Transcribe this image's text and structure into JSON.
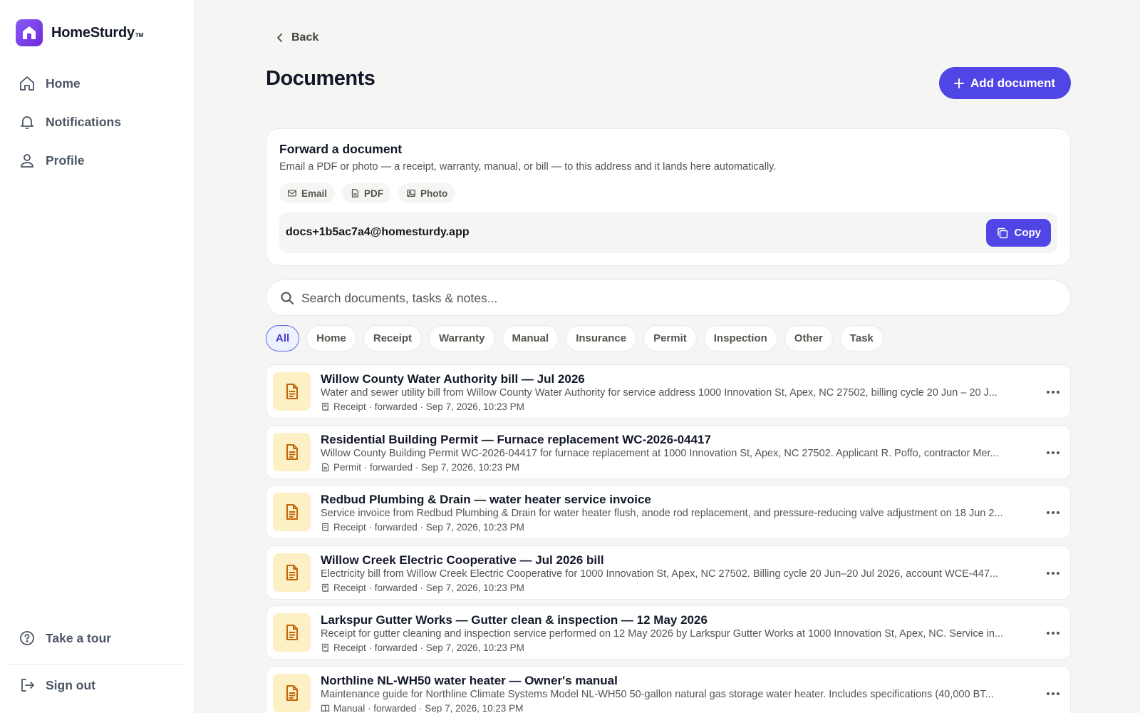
{
  "brand": {
    "name": "HomeSturdy",
    "tm": "TM"
  },
  "nav": {
    "items": [
      {
        "label": "Home",
        "icon": "home-icon"
      },
      {
        "label": "Notifications",
        "icon": "bell-icon"
      },
      {
        "label": "Profile",
        "icon": "user-icon"
      }
    ],
    "tour_label": "Take a tour",
    "signout_label": "Sign out"
  },
  "header": {
    "back_label": "Back",
    "title": "Documents",
    "add_label": "Add document"
  },
  "forward": {
    "title": "Forward a document",
    "subtitle": "Email a PDF or photo — a receipt, warranty, manual, or bill — to this address and it lands here automatically.",
    "chips": [
      "Email",
      "PDF",
      "Photo"
    ],
    "address": "docs+1b5ac7a4@homesturdy.app",
    "copy_label": "Copy"
  },
  "search": {
    "placeholder": "Search documents, tasks & notes..."
  },
  "filters": [
    "All",
    "Home",
    "Receipt",
    "Warranty",
    "Manual",
    "Insurance",
    "Permit",
    "Inspection",
    "Other",
    "Task"
  ],
  "active_filter": "All",
  "documents": [
    {
      "title": "Willow County Water Authority bill — Jul 2026",
      "description": "Water and sewer utility bill from Willow County Water Authority for service address 1000 Innovation St, Apex, NC 27502, billing cycle 20 Jun – 20 J...",
      "meta": "Receipt · forwarded · Sep 7, 2026, 10:23 PM",
      "meta_icon": "receipt-icon"
    },
    {
      "title": "Residential Building Permit — Furnace replacement WC-2026-04417",
      "description": "Willow County Building Permit WC-2026-04417 for furnace replacement at 1000 Innovation St, Apex, NC 27502. Applicant R. Poffo, contractor Mer...",
      "meta": "Permit · forwarded · Sep 7, 2026, 10:23 PM",
      "meta_icon": "permit-icon"
    },
    {
      "title": "Redbud Plumbing & Drain — water heater service invoice",
      "description": "Service invoice from Redbud Plumbing & Drain for water heater flush, anode rod replacement, and pressure-reducing valve adjustment on 18 Jun 2...",
      "meta": "Receipt · forwarded · Sep 7, 2026, 10:23 PM",
      "meta_icon": "receipt-icon"
    },
    {
      "title": "Willow Creek Electric Cooperative — Jul 2026 bill",
      "description": "Electricity bill from Willow Creek Electric Cooperative for 1000 Innovation St, Apex, NC 27502. Billing cycle 20 Jun–20 Jul 2026, account WCE-447...",
      "meta": "Receipt · forwarded · Sep 7, 2026, 10:23 PM",
      "meta_icon": "receipt-icon"
    },
    {
      "title": "Larkspur Gutter Works — Gutter clean & inspection — 12 May 2026",
      "description": "Receipt for gutter cleaning and inspection service performed on 12 May 2026 by Larkspur Gutter Works at 1000 Innovation St, Apex, NC. Service in...",
      "meta": "Receipt · forwarded · Sep 7, 2026, 10:23 PM",
      "meta_icon": "receipt-icon"
    },
    {
      "title": "Northline NL-WH50 water heater — Owner's manual",
      "description": "Maintenance guide for Northline Climate Systems Model NL-WH50 50-gallon natural gas storage water heater. Includes specifications (40,000 BT...",
      "meta": "Manual · forwarded · Sep 7, 2026, 10:23 PM",
      "meta_icon": "book-icon"
    }
  ],
  "colors": {
    "accent": "#4f46e5",
    "brand": "#7c3aed",
    "doc_icon_bg": "#fdf0c4",
    "doc_icon_fg": "#c2660c",
    "background": "#f5f5f4"
  }
}
